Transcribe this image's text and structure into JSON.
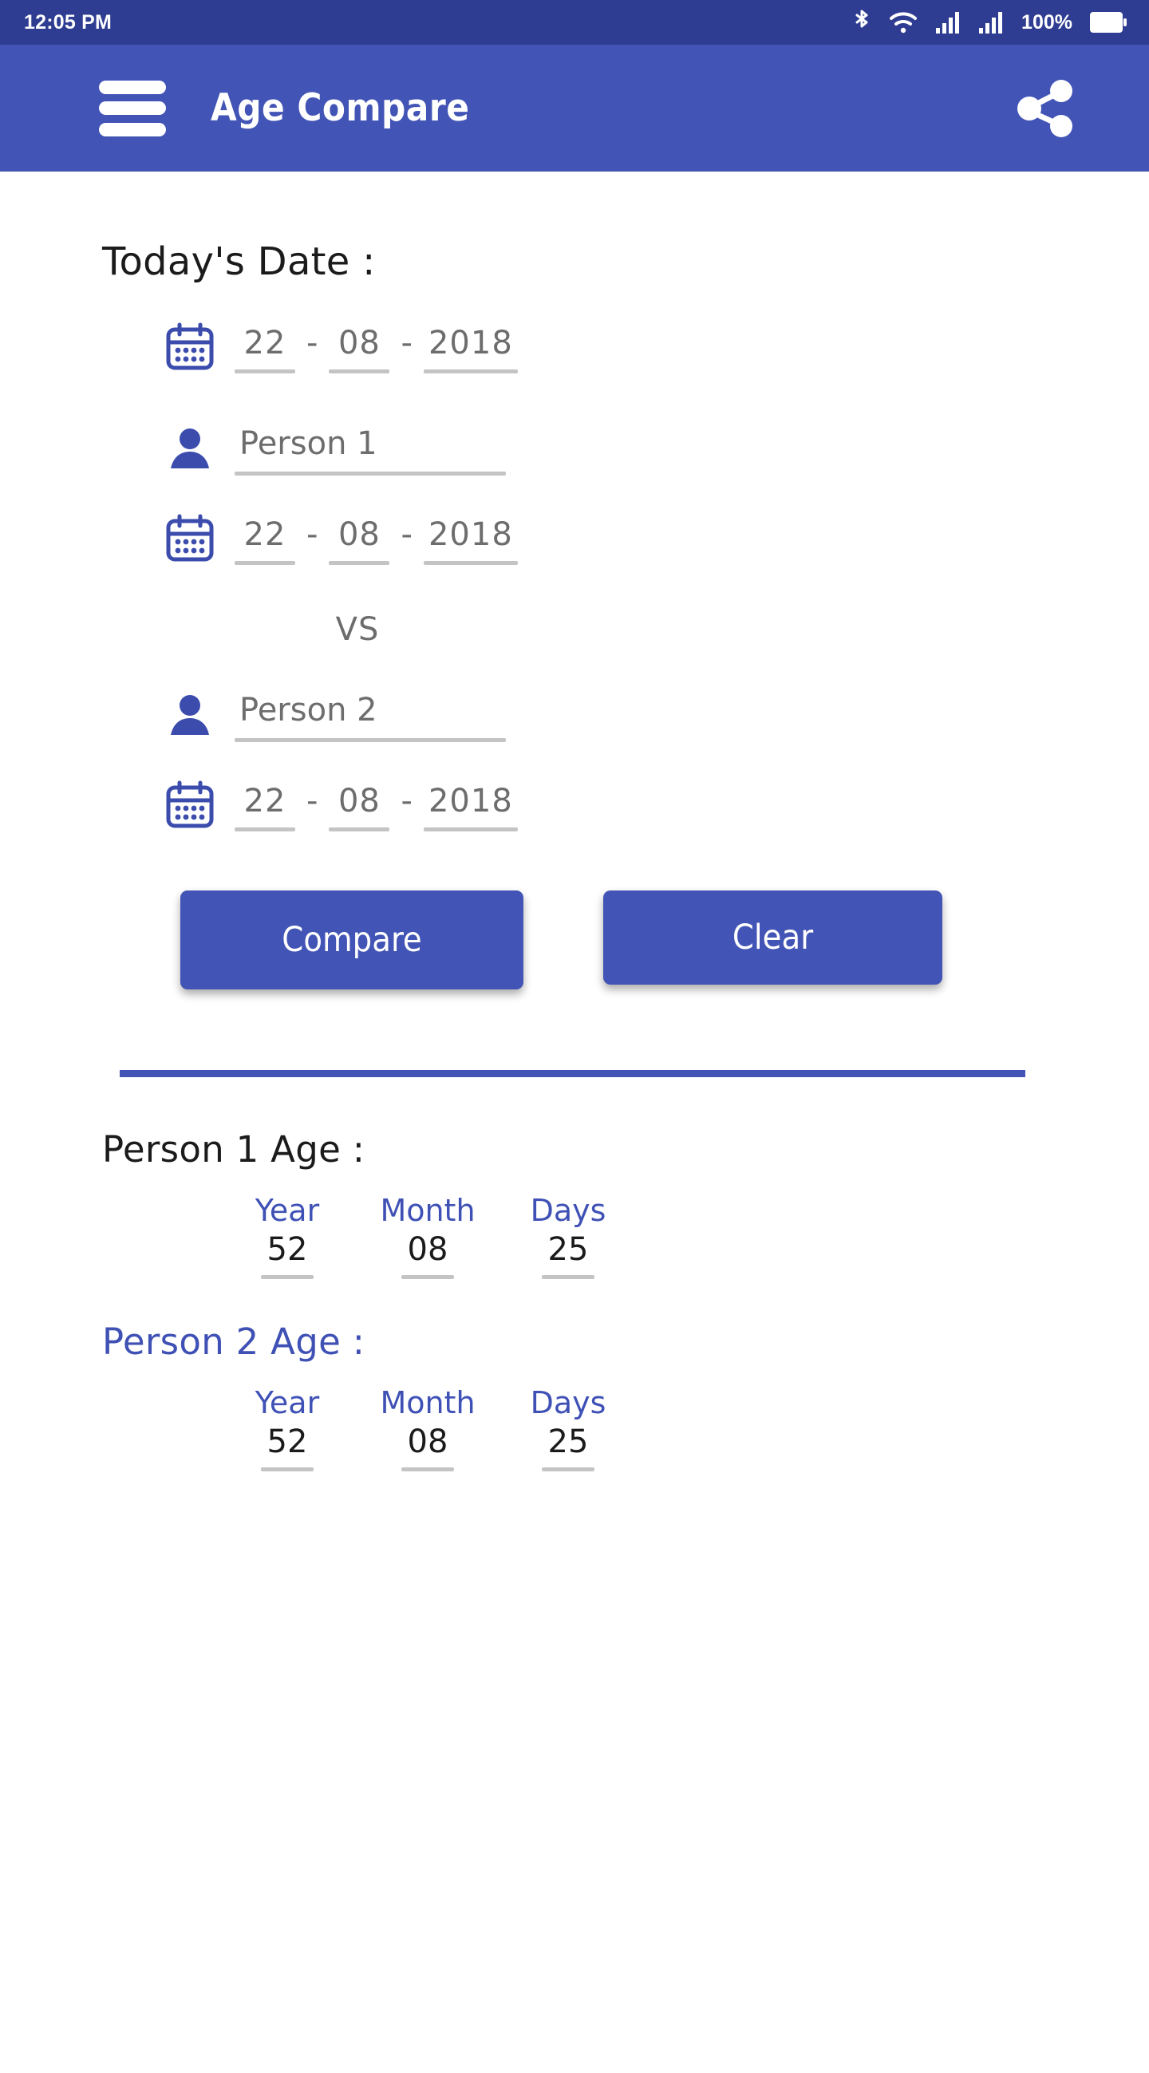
{
  "status_bar": {
    "time": "12:05 PM",
    "battery_percent": "100%",
    "icons": [
      "bluetooth-icon",
      "wifi-icon",
      "signal-icon-1",
      "signal-icon-2",
      "battery-icon"
    ],
    "background_color": "#2e3d91"
  },
  "app_bar": {
    "title": "Age Compare",
    "menu_icon": "hamburger-menu-icon",
    "share_icon": "share-icon",
    "background_color": "#4254b5"
  },
  "today": {
    "heading": "Today's Date :",
    "calendar_icon": "calendar-icon",
    "day": "22",
    "month": "08",
    "year": "2018",
    "separator": "-"
  },
  "person1": {
    "name_placeholder": "Person 1",
    "person_icon": "person-icon",
    "calendar_icon": "calendar-icon",
    "day": "22",
    "month": "08",
    "year": "2018",
    "separator": "-"
  },
  "versus_label": "VS",
  "person2": {
    "name_placeholder": "Person 2",
    "person_icon": "person-icon",
    "calendar_icon": "calendar-icon",
    "day": "22",
    "month": "08",
    "year": "2018",
    "separator": "-"
  },
  "actions": {
    "compare_label": "Compare",
    "clear_label": "Clear"
  },
  "results": {
    "headers": {
      "year": "Year",
      "month": "Month",
      "days": "Days"
    },
    "person1": {
      "title": "Person 1 Age :",
      "year": "52",
      "month": "08",
      "days": "25"
    },
    "person2": {
      "title": "Person 2 Age :",
      "year": "52",
      "month": "08",
      "days": "25"
    }
  },
  "colors": {
    "primary": "#4254b5",
    "status_bar": "#2e3d91",
    "accent_text": "#3f51b5",
    "placeholder": "#6d6d6d",
    "underline": "#c4c4c4"
  }
}
